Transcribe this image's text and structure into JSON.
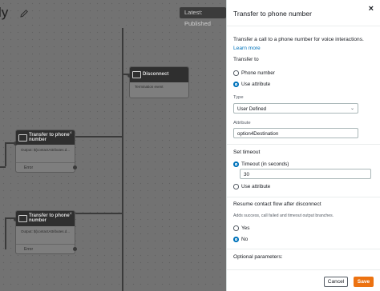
{
  "canvas": {
    "flow_title_fragment": "ly",
    "publish_status": "Latest: Published",
    "blocks": [
      {
        "title": "Disconnect",
        "subtitle": "Termination event",
        "close": "×"
      },
      {
        "title": "Transfer to phone number",
        "subtitle": "Output: $(contactAttributes.d...",
        "row": "Error",
        "close": "×"
      },
      {
        "title": "Transfer to phone number",
        "subtitle": "Output: $(contactAttributes.d...",
        "row": "Error",
        "close": "×"
      }
    ]
  },
  "panel": {
    "title": "Transfer to phone number",
    "close_label": "×",
    "description": "Transfer a call to a phone number for voice interactions.",
    "learn_more": "Learn more",
    "transfer_to": {
      "label": "Transfer to",
      "options": [
        "Phone number",
        "Use attribute"
      ],
      "selected": "Use attribute"
    },
    "type": {
      "label": "Type",
      "value": "User Defined",
      "chevron": "⌄"
    },
    "attribute": {
      "label": "Attribute",
      "value": "option4Destination"
    },
    "set_timeout": {
      "label": "Set timeout",
      "timeout_option": "Timeout (in seconds)",
      "timeout_value": "30",
      "attribute_option": "Use attribute",
      "selected": "Timeout (in seconds)"
    },
    "resume": {
      "label": "Resume contact flow after disconnect",
      "hint": "Adds success, call failed and timeout output branches.",
      "options": [
        "Yes",
        "No"
      ],
      "selected": "No"
    },
    "optional_parameters": "Optional parameters:",
    "buttons": {
      "cancel": "Cancel",
      "save": "Save"
    }
  },
  "colors": {
    "accent": "#0073bb",
    "primary_button": "#ec7211"
  }
}
